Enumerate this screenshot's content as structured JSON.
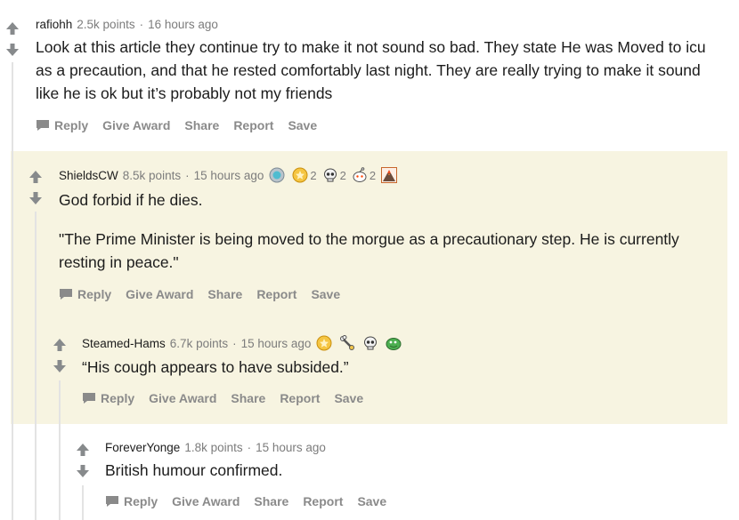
{
  "comments": [
    {
      "author": "rafiohh",
      "points": "2.5k points",
      "separator": "·",
      "time": "16 hours ago",
      "body": [
        "Look at this article they continue try to make it not sound so bad. They state He was Moved to icu as a precaution, and that he rested comfortably last night. They are really trying to make it sound like he is ok but it’s probably not my friends"
      ],
      "actions": {
        "reply": "Reply",
        "give_award": "Give Award",
        "share": "Share",
        "report": "Report",
        "save": "Save"
      }
    },
    {
      "author": "ShieldsCW",
      "points": "8.5k points",
      "separator": "·",
      "time": "15 hours ago",
      "awards": [
        {
          "icon": "silver-award-icon",
          "count": ""
        },
        {
          "icon": "gold-award-icon",
          "count": "2"
        },
        {
          "icon": "skull-award-icon",
          "count": "2"
        },
        {
          "icon": "snoo-award-icon",
          "count": "2"
        },
        {
          "icon": "volcano-award-icon",
          "count": ""
        }
      ],
      "body": [
        "God forbid if he dies.",
        "\"The Prime Minister is being moved to the morgue as a precautionary step. He is currently resting in peace.\""
      ],
      "actions": {
        "reply": "Reply",
        "give_award": "Give Award",
        "share": "Share",
        "report": "Report",
        "save": "Save"
      }
    },
    {
      "author": "Steamed-Hams",
      "points": "6.7k points",
      "separator": "·",
      "time": "15 hours ago",
      "awards": [
        {
          "icon": "gold-award-icon",
          "count": ""
        },
        {
          "icon": "bone-award-icon",
          "count": ""
        },
        {
          "icon": "skull-award-icon",
          "count": ""
        },
        {
          "icon": "frog-award-icon",
          "count": ""
        }
      ],
      "body": [
        "“His cough appears to have subsided.”"
      ],
      "actions": {
        "reply": "Reply",
        "give_award": "Give Award",
        "share": "Share",
        "report": "Report",
        "save": "Save"
      }
    },
    {
      "author": "ForeverYonge",
      "points": "1.8k points",
      "separator": "·",
      "time": "15 hours ago",
      "body": [
        "British humour confirmed."
      ],
      "actions": {
        "reply": "Reply",
        "give_award": "Give Award",
        "share": "Share",
        "report": "Report",
        "save": "Save"
      }
    }
  ],
  "colors": {
    "arrow": "#878a8c",
    "highlight_bg": "#f7f4e1",
    "meta_text": "#7c7c7c",
    "action_text": "#8a8a8a"
  }
}
